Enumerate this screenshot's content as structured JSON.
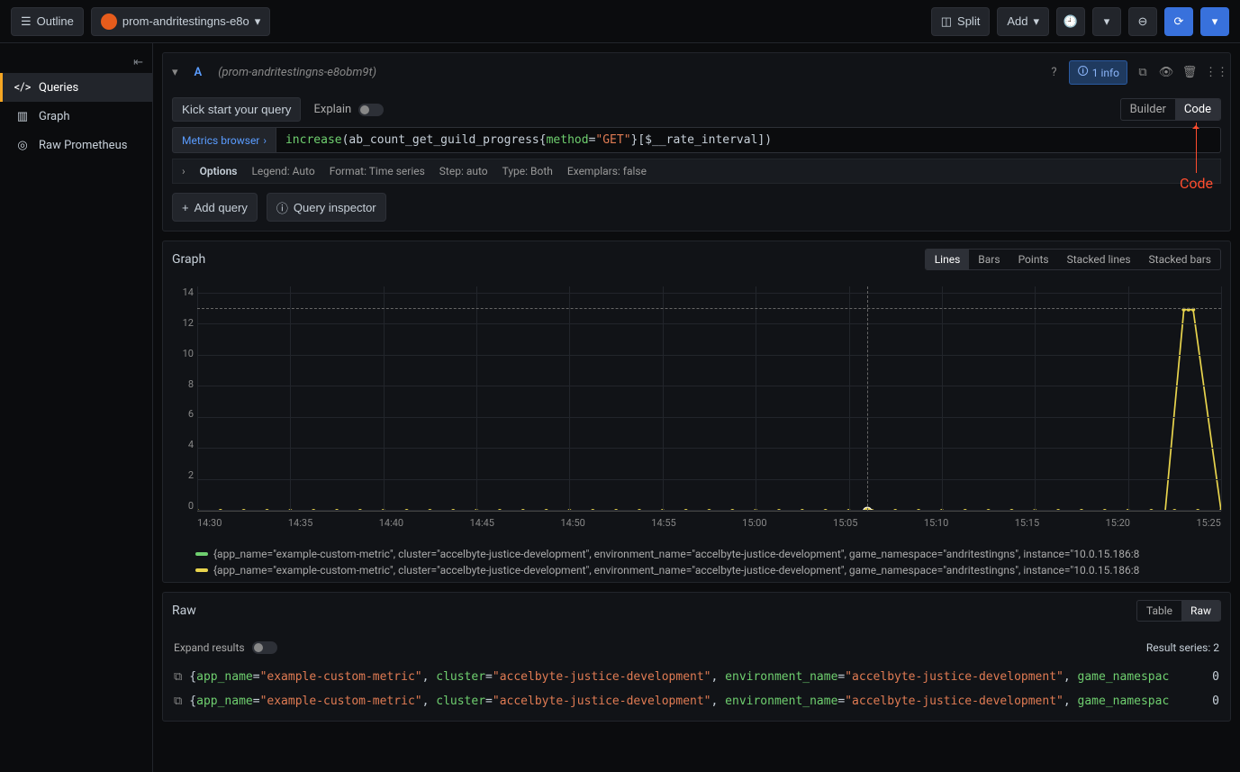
{
  "topbar": {
    "outline": "Outline",
    "datasource": "prom-andritestingns-e8o",
    "split": "Split",
    "add": "Add"
  },
  "sidebar": {
    "items": [
      {
        "label": "Queries",
        "icon": "code-icon"
      },
      {
        "label": "Graph",
        "icon": "chart-icon"
      },
      {
        "label": "Raw Prometheus",
        "icon": "prom-icon"
      }
    ]
  },
  "query": {
    "letter": "A",
    "name": "(prom-andritestingns-e8obm9t)",
    "info_chip": "1 info",
    "kick_start": "Kick start your query",
    "explain": "Explain",
    "builder": "Builder",
    "code": "Code",
    "metrics_browser": "Metrics browser",
    "code_text": {
      "fn": "increase",
      "open": "(ab_count_get_guild_progress{",
      "key": "method",
      "eq": "=",
      "val": "\"GET\"",
      "close": "}[$__rate_interval])"
    },
    "options": {
      "label": "Options",
      "legend": "Legend: Auto",
      "format": "Format: Time series",
      "step": "Step: auto",
      "type": "Type: Both",
      "exemplars": "Exemplars: false"
    },
    "add_query": "Add query",
    "query_inspector": "Query inspector"
  },
  "annotation": {
    "label": "Code"
  },
  "graph": {
    "title": "Graph",
    "tabs": [
      "Lines",
      "Bars",
      "Points",
      "Stacked lines",
      "Stacked bars"
    ],
    "active_tab": "Lines",
    "legend": [
      {
        "color": "#6fcf6f",
        "text": "{app_name=\"example-custom-metric\", cluster=\"accelbyte-justice-development\", environment_name=\"accelbyte-justice-development\", game_namespace=\"andritestingns\", instance=\"10.0.15.186:8"
      },
      {
        "color": "#e8d44d",
        "text": "{app_name=\"example-custom-metric\", cluster=\"accelbyte-justice-development\", environment_name=\"accelbyte-justice-development\", game_namespace=\"andritestingns\", instance=\"10.0.15.186:8"
      }
    ]
  },
  "chart_data": {
    "type": "line",
    "x_ticks": [
      "14:30",
      "14:35",
      "14:40",
      "14:45",
      "14:50",
      "14:55",
      "15:00",
      "15:05",
      "15:10",
      "15:15",
      "15:20",
      "15:25"
    ],
    "y_ticks": [
      0,
      2,
      4,
      6,
      8,
      10,
      12,
      14
    ],
    "ylim": [
      0,
      14.5
    ],
    "series": [
      {
        "name": "green",
        "color": "#6fcf6f",
        "values_flat": 0
      },
      {
        "name": "yellow",
        "color": "#e8d44d",
        "baseline": 0,
        "spike_start_tick": "15:22",
        "spike_end_tick": "15:24",
        "spike_value": 13,
        "values_after_spike": 0
      }
    ],
    "cursor_tick": "15:06",
    "cursor_y_dashed": 13
  },
  "raw": {
    "title": "Raw",
    "tabs": [
      "Table",
      "Raw"
    ],
    "active_tab": "Raw",
    "expand": "Expand results",
    "result_series": "Result series: 2",
    "rows": [
      {
        "expr_parts": [
          {
            "t": "{",
            "c": "p"
          },
          {
            "t": "app_name",
            "c": "k"
          },
          {
            "t": "=",
            "c": "p"
          },
          {
            "t": "\"example-custom-metric\"",
            "c": "v"
          },
          {
            "t": ", ",
            "c": "p"
          },
          {
            "t": "cluster",
            "c": "k"
          },
          {
            "t": "=",
            "c": "p"
          },
          {
            "t": "\"accelbyte-justice-development\"",
            "c": "v"
          },
          {
            "t": ", ",
            "c": "p"
          },
          {
            "t": "environment_name",
            "c": "k"
          },
          {
            "t": "=",
            "c": "p"
          },
          {
            "t": "\"accelbyte-justice-development\"",
            "c": "v"
          },
          {
            "t": ", ",
            "c": "p"
          },
          {
            "t": "game_namespac",
            "c": "k"
          }
        ],
        "value": "0"
      },
      {
        "expr_parts": [
          {
            "t": "{",
            "c": "p"
          },
          {
            "t": "app_name",
            "c": "k"
          },
          {
            "t": "=",
            "c": "p"
          },
          {
            "t": "\"example-custom-metric\"",
            "c": "v"
          },
          {
            "t": ", ",
            "c": "p"
          },
          {
            "t": "cluster",
            "c": "k"
          },
          {
            "t": "=",
            "c": "p"
          },
          {
            "t": "\"accelbyte-justice-development\"",
            "c": "v"
          },
          {
            "t": ", ",
            "c": "p"
          },
          {
            "t": "environment_name",
            "c": "k"
          },
          {
            "t": "=",
            "c": "p"
          },
          {
            "t": "\"accelbyte-justice-development\"",
            "c": "v"
          },
          {
            "t": ", ",
            "c": "p"
          },
          {
            "t": "game_namespac",
            "c": "k"
          }
        ],
        "value": "0"
      }
    ]
  }
}
